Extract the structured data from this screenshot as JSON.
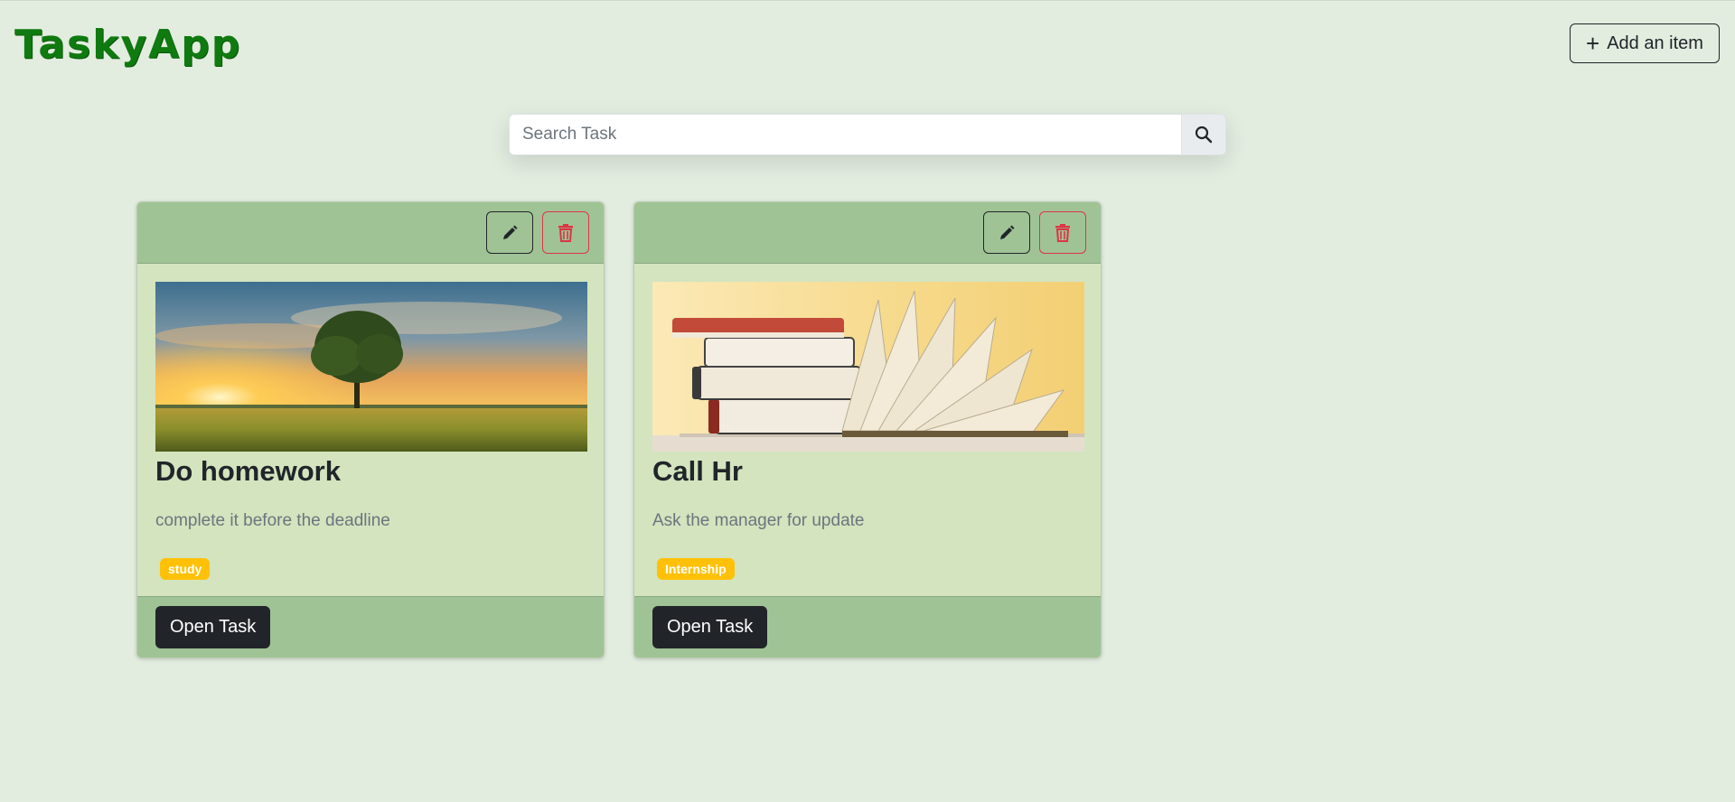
{
  "header": {
    "brand": "TaskyApp",
    "add_button_label": "Add an item"
  },
  "search": {
    "placeholder": "Search Task",
    "value": ""
  },
  "cards": [
    {
      "title": "Do homework",
      "description": "complete it before the deadline",
      "tag": "study",
      "open_label": "Open Task",
      "image": "sunset-tree-field"
    },
    {
      "title": "Call Hr",
      "description": "Ask the manager for update",
      "tag": "Internship",
      "open_label": "Open Task",
      "image": "stack-of-books"
    }
  ],
  "colors": {
    "background": "#e2ecdf",
    "brand": "#0f7a0f",
    "card_header": "#a0c396",
    "card_body": "#d3e4bf",
    "badge": "#ffc107",
    "danger": "#dc3545"
  }
}
